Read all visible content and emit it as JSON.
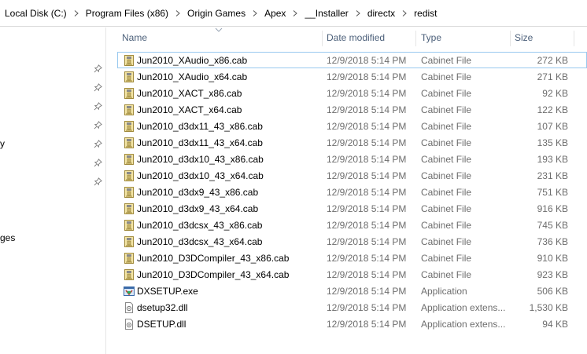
{
  "breadcrumb": [
    "Local Disk (C:)",
    "Program Files (x86)",
    "Origin Games",
    "Apex",
    "__Installer",
    "directx",
    "redist"
  ],
  "nav_fragments": [
    "y",
    "ges"
  ],
  "columns": {
    "name": "Name",
    "date": "Date modified",
    "type": "Type",
    "size": "Size"
  },
  "files": [
    {
      "name": "Jun2010_XAudio_x86.cab",
      "date": "12/9/2018 5:14 PM",
      "type": "Cabinet File",
      "size": "272 KB",
      "icon": "cabinet-file-icon"
    },
    {
      "name": "Jun2010_XAudio_x64.cab",
      "date": "12/9/2018 5:14 PM",
      "type": "Cabinet File",
      "size": "271 KB",
      "icon": "cabinet-file-icon"
    },
    {
      "name": "Jun2010_XACT_x86.cab",
      "date": "12/9/2018 5:14 PM",
      "type": "Cabinet File",
      "size": "92 KB",
      "icon": "cabinet-file-icon"
    },
    {
      "name": "Jun2010_XACT_x64.cab",
      "date": "12/9/2018 5:14 PM",
      "type": "Cabinet File",
      "size": "122 KB",
      "icon": "cabinet-file-icon"
    },
    {
      "name": "Jun2010_d3dx11_43_x86.cab",
      "date": "12/9/2018 5:14 PM",
      "type": "Cabinet File",
      "size": "107 KB",
      "icon": "cabinet-file-icon"
    },
    {
      "name": "Jun2010_d3dx11_43_x64.cab",
      "date": "12/9/2018 5:14 PM",
      "type": "Cabinet File",
      "size": "135 KB",
      "icon": "cabinet-file-icon"
    },
    {
      "name": "Jun2010_d3dx10_43_x86.cab",
      "date": "12/9/2018 5:14 PM",
      "type": "Cabinet File",
      "size": "193 KB",
      "icon": "cabinet-file-icon"
    },
    {
      "name": "Jun2010_d3dx10_43_x64.cab",
      "date": "12/9/2018 5:14 PM",
      "type": "Cabinet File",
      "size": "231 KB",
      "icon": "cabinet-file-icon"
    },
    {
      "name": "Jun2010_d3dx9_43_x86.cab",
      "date": "12/9/2018 5:14 PM",
      "type": "Cabinet File",
      "size": "751 KB",
      "icon": "cabinet-file-icon"
    },
    {
      "name": "Jun2010_d3dx9_43_x64.cab",
      "date": "12/9/2018 5:14 PM",
      "type": "Cabinet File",
      "size": "916 KB",
      "icon": "cabinet-file-icon"
    },
    {
      "name": "Jun2010_d3dcsx_43_x86.cab",
      "date": "12/9/2018 5:14 PM",
      "type": "Cabinet File",
      "size": "745 KB",
      "icon": "cabinet-file-icon"
    },
    {
      "name": "Jun2010_d3dcsx_43_x64.cab",
      "date": "12/9/2018 5:14 PM",
      "type": "Cabinet File",
      "size": "736 KB",
      "icon": "cabinet-file-icon"
    },
    {
      "name": "Jun2010_D3DCompiler_43_x86.cab",
      "date": "12/9/2018 5:14 PM",
      "type": "Cabinet File",
      "size": "910 KB",
      "icon": "cabinet-file-icon"
    },
    {
      "name": "Jun2010_D3DCompiler_43_x64.cab",
      "date": "12/9/2018 5:14 PM",
      "type": "Cabinet File",
      "size": "923 KB",
      "icon": "cabinet-file-icon"
    },
    {
      "name": "DXSETUP.exe",
      "date": "12/9/2018 5:14 PM",
      "type": "Application",
      "size": "506 KB",
      "icon": "application-exe-icon"
    },
    {
      "name": "dsetup32.dll",
      "date": "12/9/2018 5:14 PM",
      "type": "Application extens...",
      "size": "1,530 KB",
      "icon": "dll-file-icon"
    },
    {
      "name": "DSETUP.dll",
      "date": "12/9/2018 5:14 PM",
      "type": "Application extens...",
      "size": "94 KB",
      "icon": "dll-file-icon"
    }
  ],
  "colors": {
    "header_text": "#4c607a",
    "meta_text": "#6d6d6d",
    "focus_outline": "#99c9ef",
    "divider": "#e5e5e5"
  }
}
